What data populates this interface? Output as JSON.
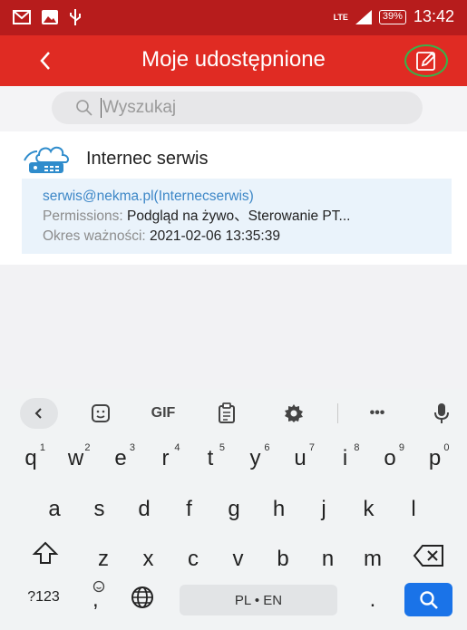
{
  "status_bar": {
    "network": "LTE",
    "battery": "39%",
    "time": "13:42"
  },
  "header": {
    "title": "Moje udostępnione",
    "back_icon": "chevron-left-icon",
    "edit_icon": "edit-pencil-icon"
  },
  "search": {
    "placeholder": "Wyszukaj"
  },
  "share": {
    "device_name": "Internec serwis",
    "email": "serwis@nekma.pl(Internecserwis)",
    "permissions_label": "Permissions:",
    "permissions_value": "Podgląd na żywo、Sterowanie PT...",
    "validity_label": "Okres ważności:",
    "validity_value": "2021-02-06 13:35:39"
  },
  "keyboard": {
    "toolbar": {
      "gif": "GIF",
      "more": "•••"
    },
    "row1": [
      "q",
      "w",
      "e",
      "r",
      "t",
      "y",
      "u",
      "i",
      "o",
      "p"
    ],
    "row1_nums": [
      "1",
      "2",
      "3",
      "4",
      "5",
      "6",
      "7",
      "8",
      "9",
      "0"
    ],
    "row2": [
      "a",
      "s",
      "d",
      "f",
      "g",
      "h",
      "j",
      "k",
      "l"
    ],
    "row3": [
      "z",
      "x",
      "c",
      "v",
      "b",
      "n",
      "m"
    ],
    "symbols_key": "?123",
    "comma_key": ",",
    "space_label": "PL • EN",
    "period_key": "."
  }
}
